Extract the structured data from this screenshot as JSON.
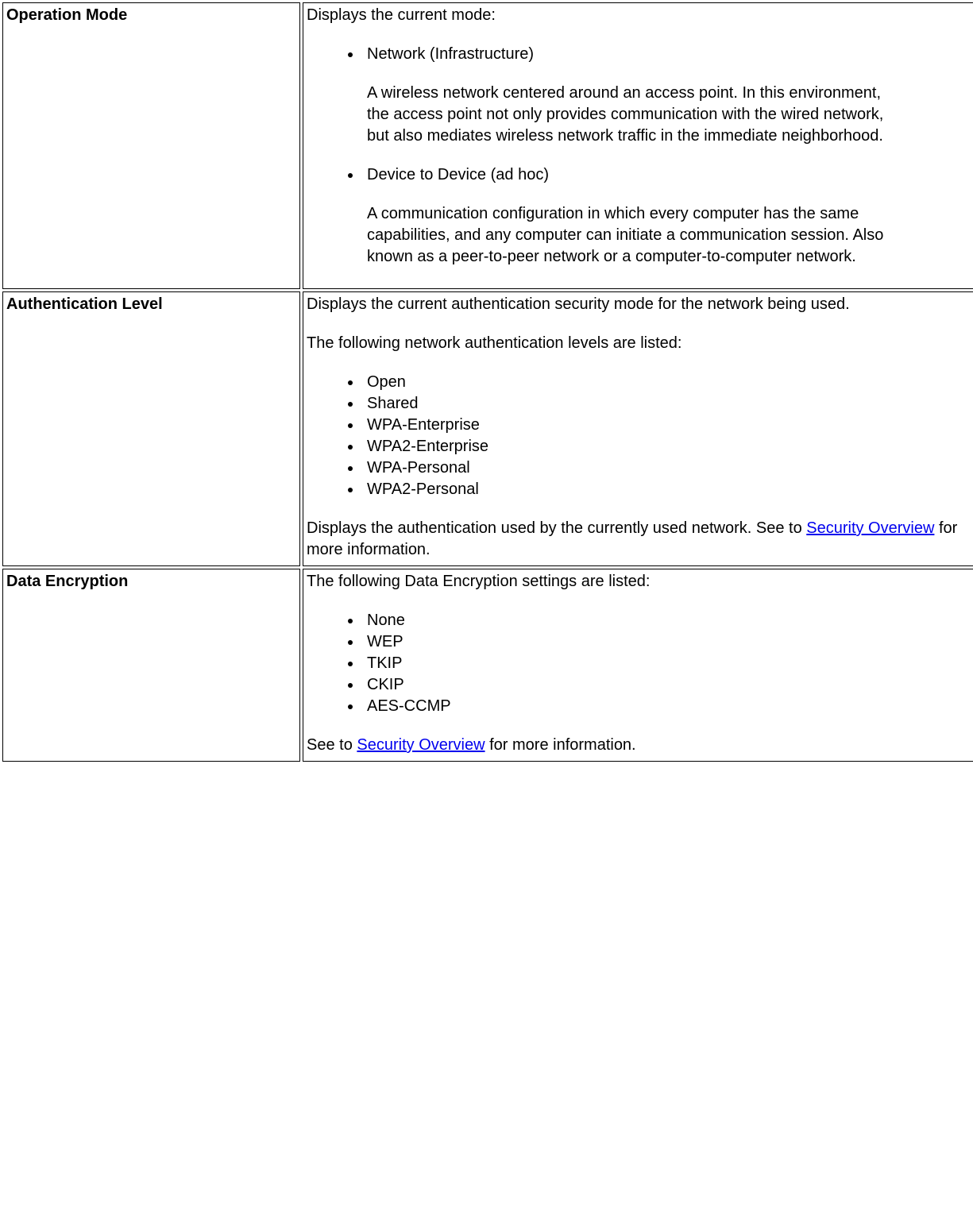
{
  "rows": [
    {
      "label": "Operation Mode",
      "intro": "Displays the current mode:",
      "modes": [
        {
          "title": "Network (Infrastructure)",
          "body": "A wireless network centered around an access point. In this environment, the access point not only provides communication with the wired network, but also mediates wireless network traffic in the immediate neighborhood."
        },
        {
          "title": "Device to Device (ad hoc)",
          "body": "A communication configuration in which every computer has the same capabilities, and any computer can initiate a communication session. Also known as a peer-to-peer network or a computer-to-computer network."
        }
      ]
    },
    {
      "label": "Authentication Level",
      "para1": "Displays the current authentication security mode for the network being used.",
      "para2": "The following network authentication levels are listed:",
      "items": [
        "Open",
        "Shared",
        "WPA-Enterprise",
        "WPA2-Enterprise",
        "WPA-Personal",
        "WPA2-Personal"
      ],
      "outro_before": "Displays the authentication used by the currently used network. See to ",
      "link_text": "Security Overview",
      "outro_after": " for more information."
    },
    {
      "label": "Data Encryption",
      "para1": "The following Data Encryption settings are listed:",
      "items": [
        "None",
        "WEP",
        "TKIP",
        "CKIP",
        "AES-CCMP"
      ],
      "outro_before": "See to ",
      "link_text": "Security Overview",
      "outro_after": " for more information."
    }
  ]
}
